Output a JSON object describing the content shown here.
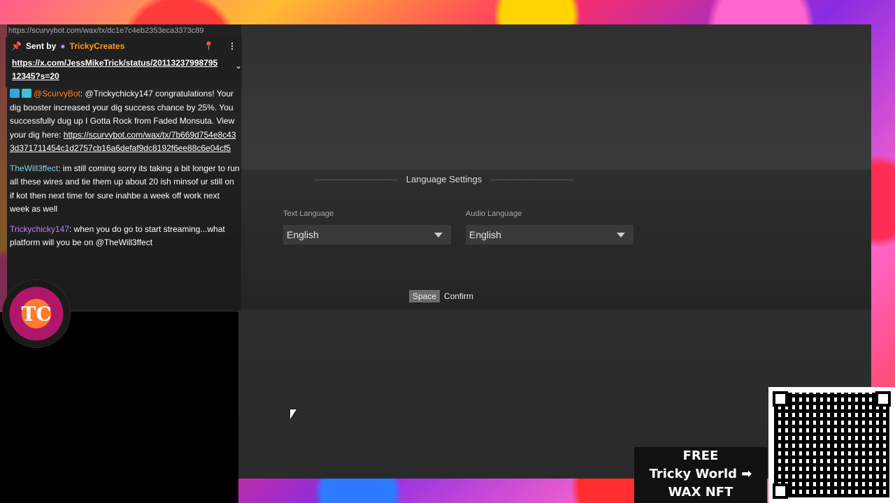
{
  "chat": {
    "top_url": "https://scurvybot.com/wax/tx/dc1e7c4eb2353eca3373c89",
    "pinned": {
      "sent_by_label": "Sent by",
      "sender": "TrickyCreates",
      "link": "https://x.com/JessMikeTrick/status/2011323799879512345?s=20"
    },
    "messages": [
      {
        "user": "@ScurvyBot",
        "text": ": @Trickychicky147 congratulations! Your dig booster increased your dig success chance by 25%. You successfully dug up I Gotta Rock from Faded Monsuta. View your dig here: ",
        "link": "https://scurvybot.com/wax/tx/7b669d754e8c433d371711454c1d2757cb16a6defaf9dc8192f6ee88c6e04cf5"
      },
      {
        "user": "TheWill3ffect",
        "text": ": im still coming sorry its taking a bit longer to run all these wires and tie them up about 20 ish minsof ur still on if kot then next time for sure inahbe a week off work next week as well"
      },
      {
        "user": "Trickychicky147",
        "text": ": when you do go to start streaming...what platform will you be on @TheWill3ffect"
      }
    ]
  },
  "settings": {
    "section_title": "Language Settings",
    "text_language_label": "Text Language",
    "text_language_value": "English",
    "audio_language_label": "Audio Language",
    "audio_language_value": "English",
    "confirm_key": "Space",
    "confirm_label": "Confirm"
  },
  "overlay": {
    "logo_text": "TC",
    "promo_line1": "FREE",
    "promo_line2": "Tricky World ➡",
    "promo_line3": "WAX NFT"
  }
}
